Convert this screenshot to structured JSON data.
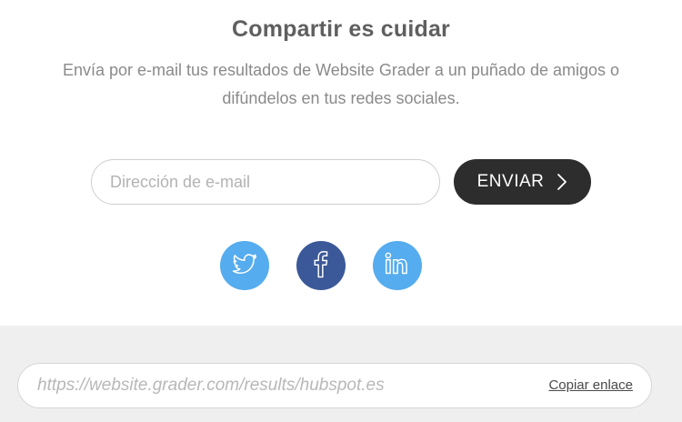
{
  "share": {
    "title": "Compartir es cuidar",
    "description": "Envía por e-mail tus resultados de Website Grader a un puñado de amigos o difúndelos en tus redes sociales."
  },
  "email_form": {
    "placeholder": "Dirección de e-mail",
    "value": "",
    "send_label": "ENVIAR",
    "send_icon": "chevron-right-icon"
  },
  "social": [
    {
      "name": "twitter",
      "icon": "twitter-icon",
      "color": "#55acee"
    },
    {
      "name": "facebook",
      "icon": "facebook-icon",
      "color": "#3b5998"
    },
    {
      "name": "linkedin",
      "icon": "linkedin-icon",
      "color": "#55acee"
    }
  ],
  "link_bar": {
    "url": "https://website.grader.com/results/hubspot.es",
    "copy_label": "Copiar enlace"
  },
  "colors": {
    "button_dark": "#2d2d2d",
    "bottom_bg": "#efefef",
    "title_text": "#5f5f5f",
    "body_text": "#8a8a8a"
  }
}
